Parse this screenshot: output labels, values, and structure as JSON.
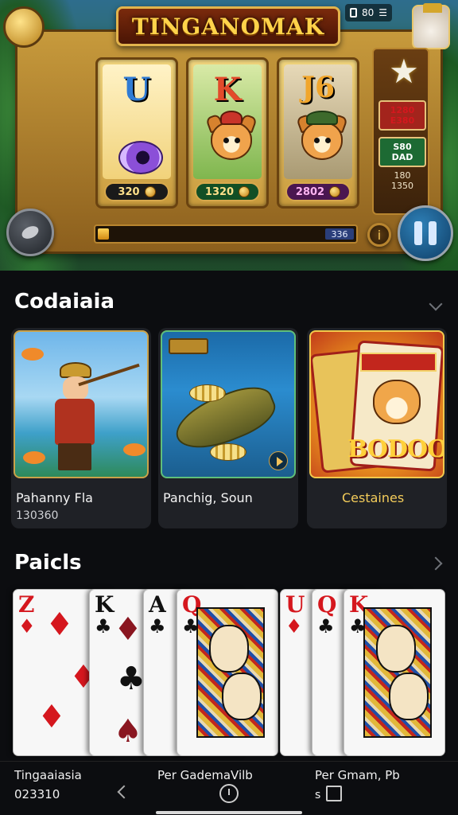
{
  "status_bar": {
    "icon": "lock-icon",
    "text": "80",
    "extra": "☰"
  },
  "slot": {
    "title": "TINGANOMAK",
    "reels": [
      {
        "letter": "U",
        "value": "320",
        "icon": "purple-eye-icon"
      },
      {
        "letter": "K",
        "value": "1320",
        "icon": "dog-hero-icon"
      },
      {
        "letter": "J6",
        "value": "2802",
        "icon": "dog-hat-icon"
      }
    ],
    "side": {
      "red_line1": "1280",
      "red_line2": "E380",
      "green_line1": "S80",
      "green_line2": "DAD",
      "stat_line1": "180",
      "stat_line2": "1350"
    },
    "progress": {
      "value_fraction": 0.05,
      "right_text": "336"
    },
    "pause_icon": "pause-icon",
    "info_icon": "info-icon"
  },
  "games_section": {
    "title": "Codaiaia",
    "games": [
      {
        "name": "Pahanny Fla",
        "sub": "130360",
        "art": "pirate-fishing"
      },
      {
        "name": "Panchig, Soun",
        "sub": "",
        "art": "fish-bait"
      },
      {
        "name": "Cestaines",
        "sub": "",
        "art": "bodoo-card",
        "art_text": "BODOO"
      }
    ]
  },
  "cards_section": {
    "title": "Paicls",
    "cards": [
      {
        "rank": "Z",
        "suit": "♦",
        "color": "red"
      },
      {
        "rank": "K",
        "suit": "♣",
        "color": "black"
      },
      {
        "rank": "A",
        "suit": "♣",
        "color": "black"
      },
      {
        "rank": "Q",
        "suit": "♣",
        "color": "black"
      },
      {
        "rank": "U",
        "suit": "♦",
        "color": "red"
      },
      {
        "rank": "Q",
        "suit": "♣",
        "color": "black"
      },
      {
        "rank": "K",
        "suit": "♣",
        "color": "black"
      }
    ]
  },
  "bottom_nav": {
    "left_label": "Tingaaiasia",
    "left_sub": "023310",
    "mid_label": "Per GademaVilb",
    "right_label": "Per Gmam, Pb",
    "right_prefix": "s"
  }
}
